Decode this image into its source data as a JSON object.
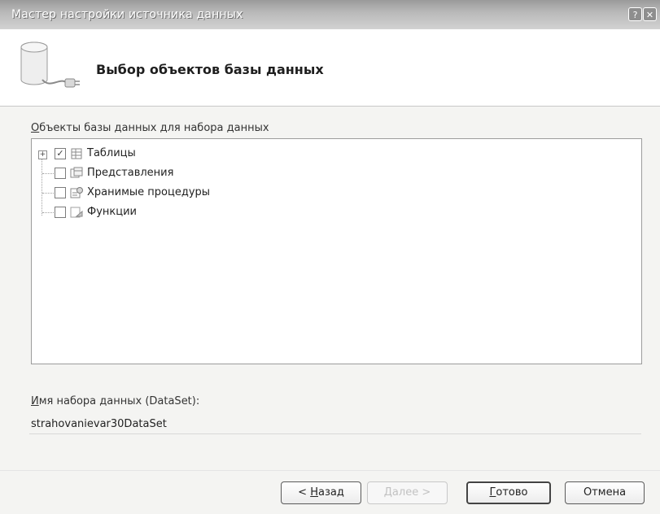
{
  "window": {
    "title": "Мастер настройки источника данных",
    "help_label": "?",
    "close_label": "✕"
  },
  "header": {
    "title": "Выбор объектов базы данных",
    "icon": "database-connect-icon"
  },
  "objects_section": {
    "label_access_key": "О",
    "label_rest": "бъекты базы данных для набора данных",
    "items": [
      {
        "label": "Таблицы",
        "checked": true,
        "expandable": true,
        "icon": "table-icon"
      },
      {
        "label": "Представления",
        "checked": false,
        "expandable": false,
        "icon": "view-icon"
      },
      {
        "label": "Хранимые процедуры",
        "checked": false,
        "expandable": false,
        "icon": "stored-procedure-icon"
      },
      {
        "label": "Функции",
        "checked": false,
        "expandable": false,
        "icon": "function-icon"
      }
    ],
    "expander_symbol": "+",
    "check_symbol": "✓"
  },
  "dataset": {
    "label_access_key": "И",
    "label_rest": "мя набора данных (DataSet):",
    "value": "strahovanievar30DataSet"
  },
  "buttons": {
    "back_prefix": "< ",
    "back_access_key": "Н",
    "back_rest": "азад",
    "next_label": "Далее >",
    "finish_access_key": "Г",
    "finish_rest": "отово",
    "cancel_label": "Отмена"
  }
}
